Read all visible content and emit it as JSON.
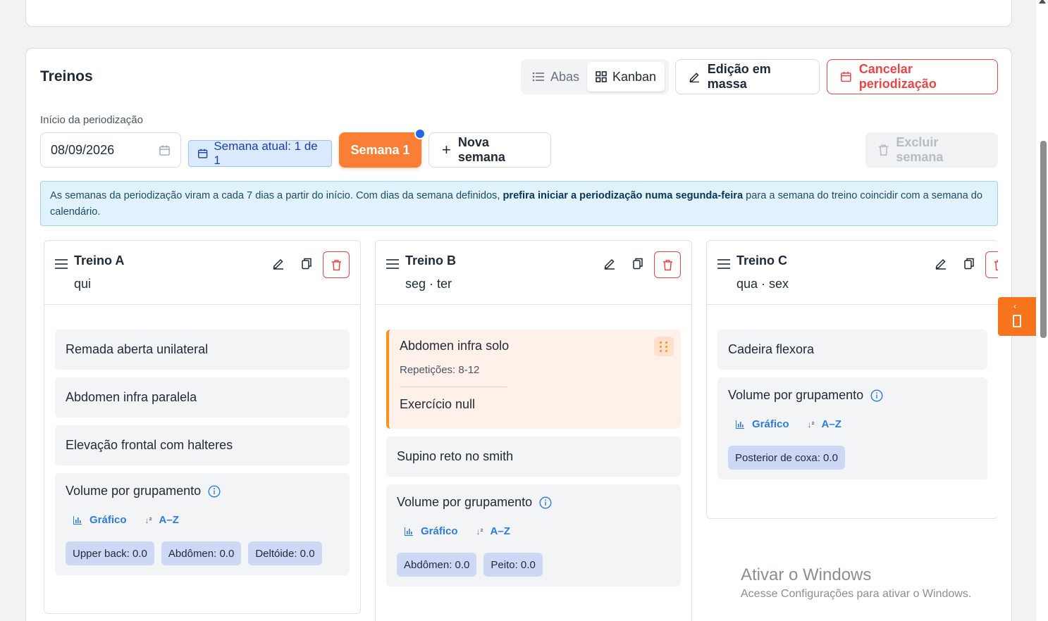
{
  "section": {
    "title": "Treinos",
    "view_toggle": {
      "tabs_label": "Abas",
      "kanban_label": "Kanban",
      "active": "Kanban"
    },
    "mass_edit_label": "Edição em massa",
    "cancel_label": "Cancelar periodização",
    "start_label": "Início da periodização",
    "start_date": "08/09/2026",
    "current_week": "Semana atual: 1 de 1",
    "week_tab": "Semana 1",
    "new_week_label": "Nova semana",
    "delete_week_label": "Excluir semana",
    "info_part1": "As semanas da periodização viram a cada 7 dias a partir do início. Com dias da semana definidos, ",
    "info_bold": "prefira iniciar a periodização numa segunda-feira",
    "info_part2": " para a semana do treino coincidir com a semana do calendário."
  },
  "columns": [
    {
      "name": "Treino A",
      "days": "qui",
      "exercises": [
        "Remada aberta unilateral",
        "Abdomen infra paralela",
        "Elevação frontal com halteres"
      ],
      "volume": {
        "title": "Volume por grupamento",
        "tab_chart": "Gráfico",
        "tab_az": "A–Z",
        "chips": [
          "Upper back: 0.0",
          "Abdômen: 0.0",
          "Deltóide: 0.0"
        ]
      }
    },
    {
      "name": "Treino B",
      "days": "seg · ter",
      "active_exercise": {
        "name": "Abdomen infra solo",
        "reps": "Repetições: 8-12",
        "second": "Exercício null"
      },
      "exercises": [
        "Supino reto no smith"
      ],
      "volume": {
        "title": "Volume por grupamento",
        "tab_chart": "Gráfico",
        "tab_az": "A–Z",
        "chips": [
          "Abdômen: 0.0",
          "Peito: 0.0"
        ]
      }
    },
    {
      "name": "Treino C",
      "days": "qua · sex",
      "exercises": [
        "Cadeira flexora"
      ],
      "volume": {
        "title": "Volume por grupamento",
        "tab_chart": "Gráfico",
        "tab_az": "A–Z",
        "chips": [
          "Posterior de coxa: 0.0"
        ]
      }
    }
  ],
  "watermark": {
    "line1": "Ativar o Windows",
    "line2": "Acesse Configurações para ativar o Windows."
  },
  "colors": {
    "accent_orange": "#fb7e36",
    "danger": "#ef4444",
    "link_blue": "#2c7be5",
    "info_bg": "#e0f3fc"
  }
}
